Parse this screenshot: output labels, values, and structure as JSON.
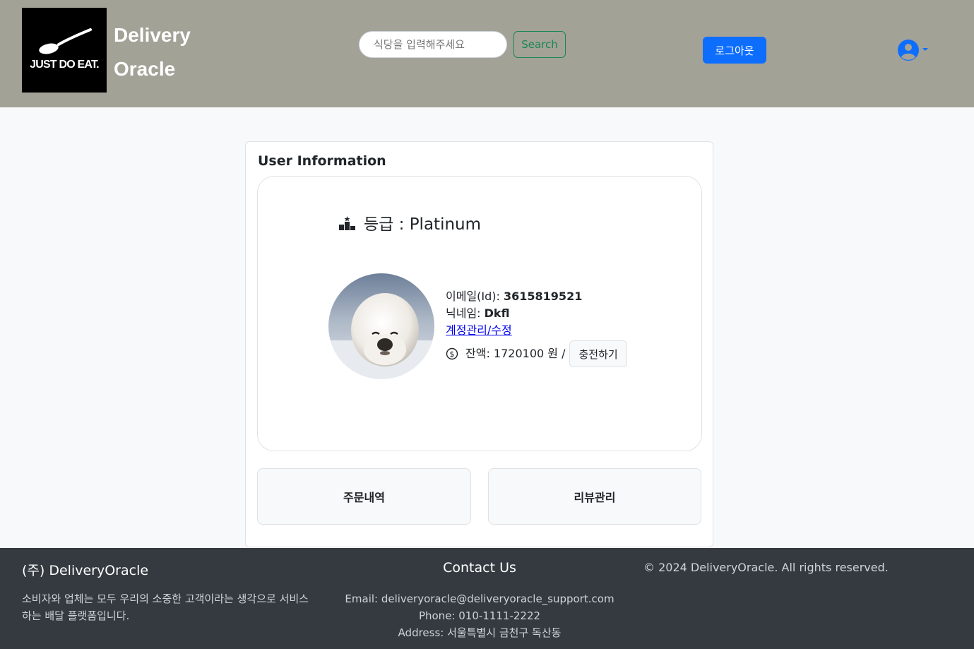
{
  "header": {
    "logo_text": "JUST DO EAT.",
    "brand_line1": "Delivery",
    "brand_line2": "Oracle",
    "search_placeholder": "식당을 입력해주세요",
    "search_button": "Search",
    "logout_button": "로그아웃",
    "user_icon": "user-circle-icon"
  },
  "card": {
    "title": "User Information",
    "grade_label": "등급 : Platinum",
    "grade_icon": "podium-icon",
    "avatar_alt": "profile photo of a white seal pup",
    "email_label": "이메일(Id): ",
    "email_value": "3615819521",
    "nickname_label": "닉네임: ",
    "nickname_value": "Dkfl",
    "account_link": "계정관리/수정",
    "balance_text": "잔액: 1720100 원 /",
    "balance_icon": "dollar-circle-icon",
    "charge_button": "충전하기",
    "orders_button": "주문내역",
    "reviews_button": "리뷰관리"
  },
  "footer": {
    "company": "(주) DeliveryOracle",
    "description": "소비자와 업체는 모두 우리의 소중한 고객이라는 생각으로 서비스하는 배달 플랫폼입니다.",
    "contact_title": "Contact Us",
    "email": "Email: deliveryoracle@deliveryoracle_support.com",
    "phone": "Phone: 010-1111-2222",
    "address": "Address: 서울특별시 금천구 독산동",
    "copyright": "© 2024 DeliveryOracle. All rights reserved."
  },
  "colors": {
    "header_bg": "#a3a297",
    "primary": "#0d6efd",
    "success": "#198754",
    "footer_bg": "#343a40"
  }
}
